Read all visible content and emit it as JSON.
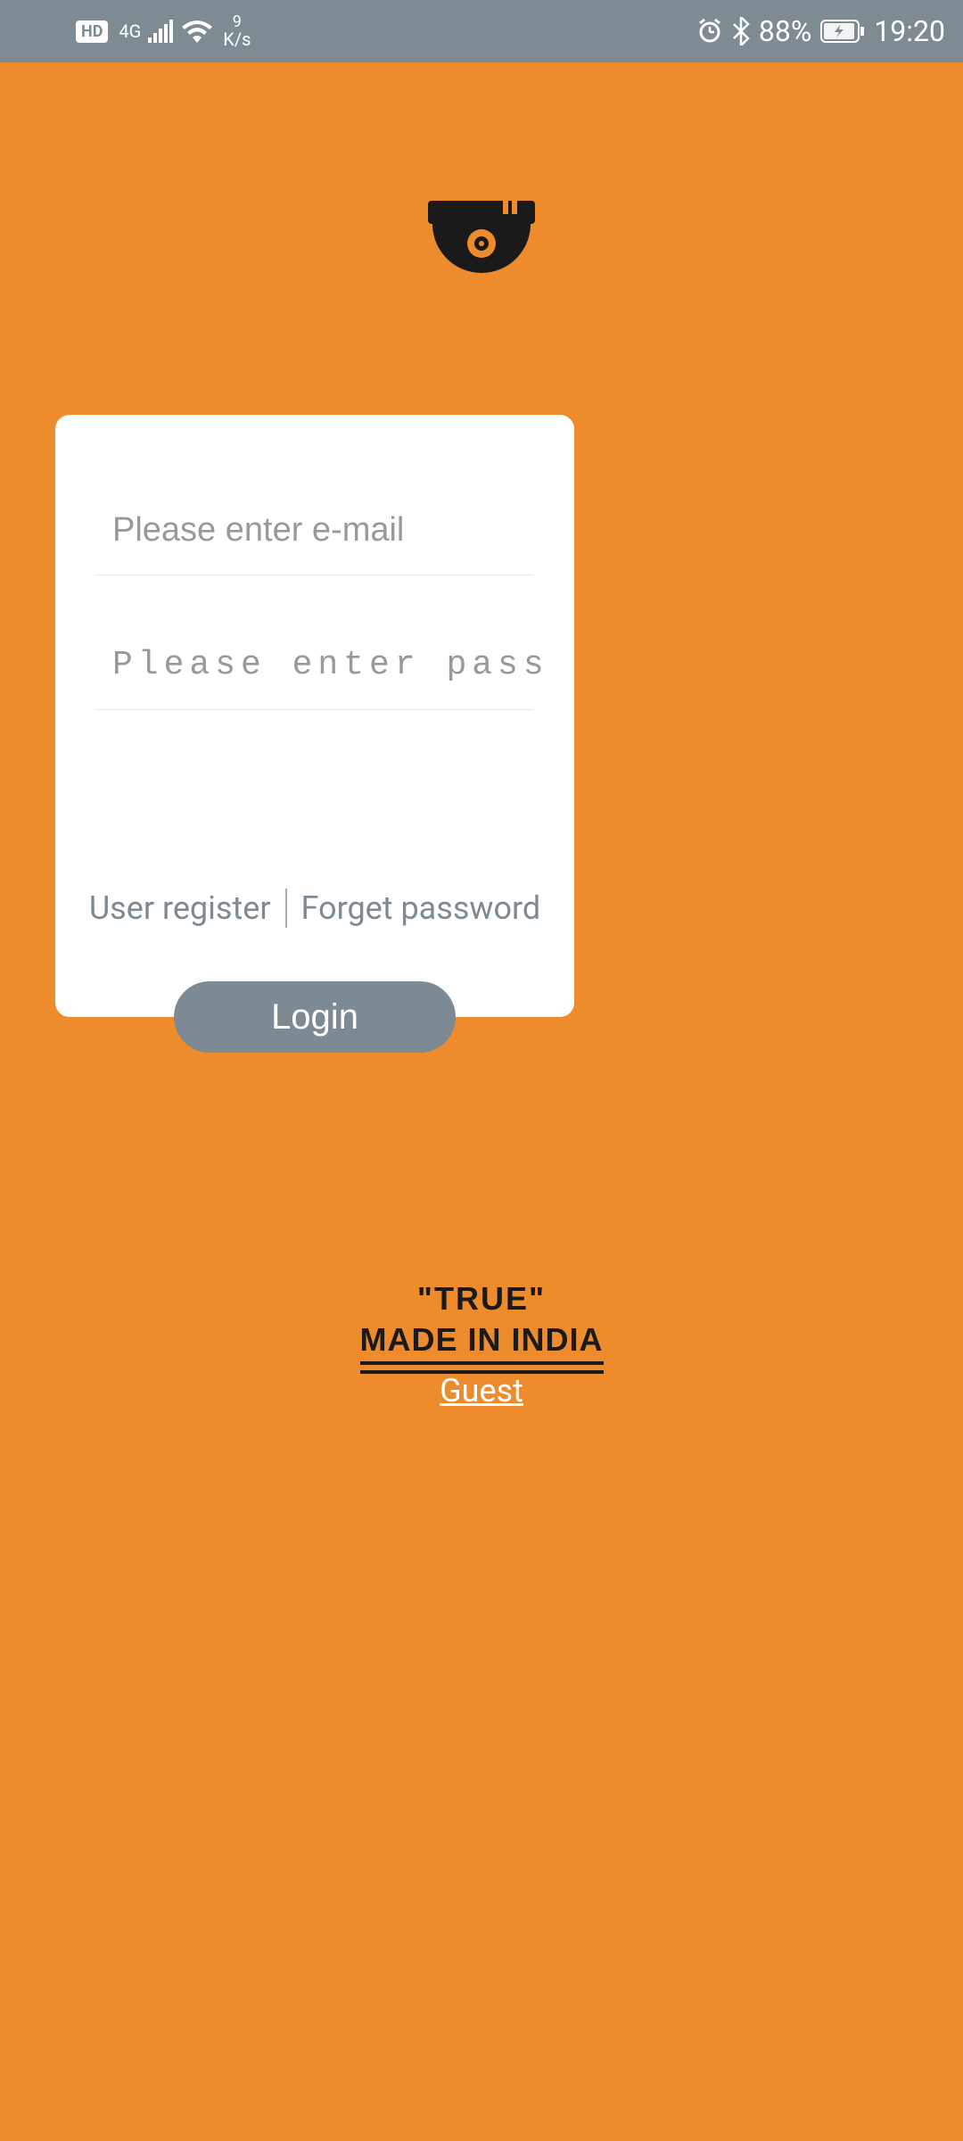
{
  "status_bar": {
    "hd": "HD",
    "network_type": "4G",
    "speed_value": "9",
    "speed_unit": "K/s",
    "battery_percent": "88%",
    "time": "19:20"
  },
  "login": {
    "email_placeholder": "Please enter e-mail",
    "password_placeholder": "Please enter password",
    "register_link": "User register",
    "forget_link": "Forget password",
    "login_button": "Login"
  },
  "brand": {
    "line1": "\"TRUE\"",
    "line2": "MADE IN INDIA"
  },
  "footer": {
    "guest": "Guest"
  }
}
